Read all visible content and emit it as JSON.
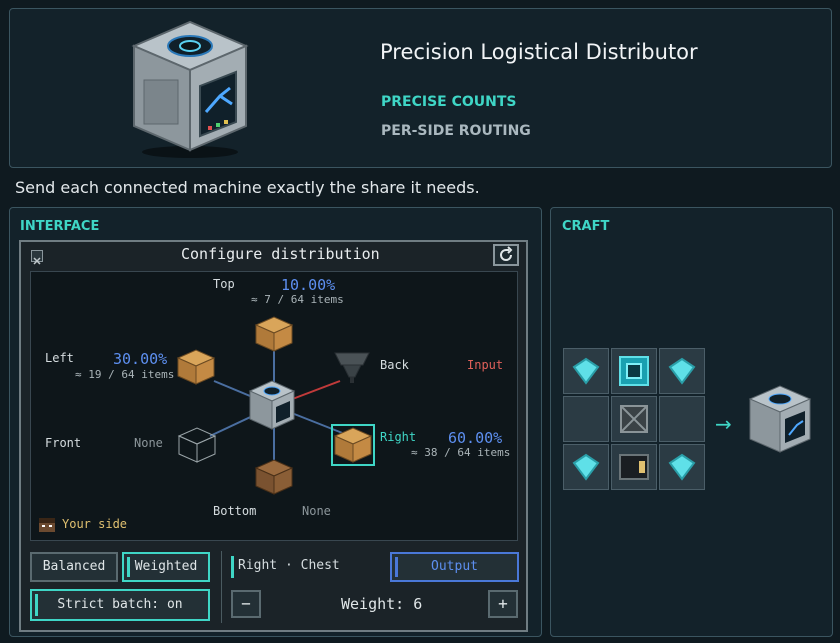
{
  "product": {
    "title": "Precision Logistical Distributor",
    "features": [
      "PRECISE COUNTS",
      "PER-SIDE ROUTING"
    ],
    "tagline": "Send each connected machine exactly the share it needs."
  },
  "interface": {
    "header": "INTERFACE",
    "window_title": "Configure distribution",
    "sides": {
      "top": {
        "label": "Top",
        "percent": "10.00%",
        "count": "≈ 7 / 64 items"
      },
      "left": {
        "label": "Left",
        "percent": "30.00%",
        "count": "≈ 19 / 64 items"
      },
      "back": {
        "label": "Back",
        "status": "Input"
      },
      "right": {
        "label": "Right",
        "percent": "60.00%",
        "count": "≈ 38 / 64 items"
      },
      "front": {
        "label": "Front",
        "status": "None"
      },
      "bottom": {
        "label": "Bottom",
        "status": "None"
      }
    },
    "your_side": "Your side",
    "modes": {
      "balanced": "Balanced",
      "weighted": "Weighted",
      "selected": "Weighted"
    },
    "strict_batch": "Strict batch: on",
    "selection": "Right · Chest",
    "output_button": "Output",
    "minus": "−",
    "plus": "+",
    "weight": "Weight: 6"
  },
  "craft": {
    "header": "CRAFT",
    "arrow": "→",
    "grid": [
      "diamond",
      "ender-eye",
      "diamond",
      "empty",
      "iron-frame",
      "empty",
      "diamond",
      "processor",
      "diamond"
    ],
    "result": "distributor"
  },
  "colors": {
    "accent": "#3fd6c6",
    "percent": "#5d8ff0",
    "input": "#e0605a",
    "gold": "#e0c070"
  }
}
